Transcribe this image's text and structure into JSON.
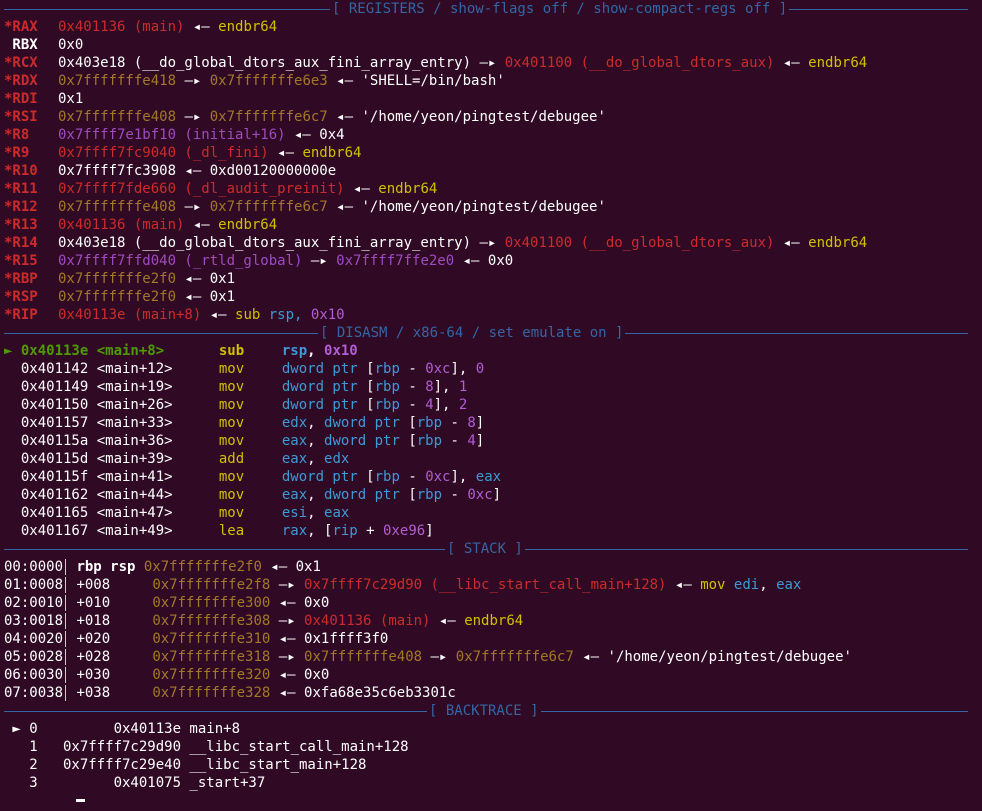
{
  "headers": {
    "registers": "[ REGISTERS / show-flags off / show-compact-regs off ]",
    "disasm": "[ DISASM / x86-64 / set emulate on ]",
    "stack": "[ STACK ]",
    "backtrace": "[ BACKTRACE ]"
  },
  "registers": [
    {
      "name": "*RAX",
      "parts": [
        [
          "0x401136 (main)",
          "red"
        ],
        [
          " ◂— ",
          "wht"
        ],
        [
          "endbr64",
          "ylw"
        ]
      ]
    },
    {
      "name": " RBX",
      "parts": [
        [
          "0x0",
          "wht"
        ]
      ]
    },
    {
      "name": "*RCX",
      "parts": [
        [
          "0x403e18 (__do_global_dtors_aux_fini_array_entry)",
          "wht"
        ],
        [
          " —▸ ",
          "wht"
        ],
        [
          "0x401100 (__do_global_dtors_aux)",
          "red"
        ],
        [
          " ◂— ",
          "wht"
        ],
        [
          "endbr64",
          "ylw"
        ]
      ]
    },
    {
      "name": "*RDX",
      "parts": [
        [
          "0x7fffffffe418",
          "brn"
        ],
        [
          " —▸ ",
          "wht"
        ],
        [
          "0x7fffffffe6e3",
          "brn"
        ],
        [
          " ◂— 'SHELL=/bin/bash'",
          "wht"
        ]
      ]
    },
    {
      "name": "*RDI",
      "parts": [
        [
          "0x1",
          "wht"
        ]
      ]
    },
    {
      "name": "*RSI",
      "parts": [
        [
          "0x7fffffffe408",
          "brn"
        ],
        [
          " —▸ ",
          "wht"
        ],
        [
          "0x7fffffffe6c7",
          "brn"
        ],
        [
          " ◂— '/home/yeon/pingtest/debugee'",
          "wht"
        ]
      ]
    },
    {
      "name": "*R8",
      "parts": [
        [
          "0x7ffff7e1bf10 (initial+16)",
          "pur"
        ],
        [
          " ◂— 0x4",
          "wht"
        ]
      ]
    },
    {
      "name": "*R9",
      "parts": [
        [
          "0x7ffff7fc9040 (_dl_fini)",
          "red"
        ],
        [
          " ◂— ",
          "wht"
        ],
        [
          "endbr64",
          "ylw"
        ]
      ]
    },
    {
      "name": "*R10",
      "parts": [
        [
          "0x7ffff7fc3908",
          "wht"
        ],
        [
          " ◂— 0xd00120000000e",
          "wht"
        ]
      ]
    },
    {
      "name": "*R11",
      "parts": [
        [
          "0x7ffff7fde660 (_dl_audit_preinit)",
          "red"
        ],
        [
          " ◂— ",
          "wht"
        ],
        [
          "endbr64",
          "ylw"
        ]
      ]
    },
    {
      "name": "*R12",
      "parts": [
        [
          "0x7fffffffe408",
          "brn"
        ],
        [
          " —▸ ",
          "wht"
        ],
        [
          "0x7fffffffe6c7",
          "brn"
        ],
        [
          " ◂— '/home/yeon/pingtest/debugee'",
          "wht"
        ]
      ]
    },
    {
      "name": "*R13",
      "parts": [
        [
          "0x401136 (main)",
          "red"
        ],
        [
          " ◂— ",
          "wht"
        ],
        [
          "endbr64",
          "ylw"
        ]
      ]
    },
    {
      "name": "*R14",
      "parts": [
        [
          "0x403e18 (__do_global_dtors_aux_fini_array_entry)",
          "wht"
        ],
        [
          " —▸ ",
          "wht"
        ],
        [
          "0x401100 (__do_global_dtors_aux)",
          "red"
        ],
        [
          " ◂— ",
          "wht"
        ],
        [
          "endbr64",
          "ylw"
        ]
      ]
    },
    {
      "name": "*R15",
      "parts": [
        [
          "0x7ffff7ffd040 (_rtld_global)",
          "pur"
        ],
        [
          " —▸ ",
          "wht"
        ],
        [
          "0x7ffff7ffe2e0",
          "pur"
        ],
        [
          " ◂— 0x0",
          "wht"
        ]
      ]
    },
    {
      "name": "*RBP",
      "parts": [
        [
          "0x7fffffffe2f0",
          "brn"
        ],
        [
          " ◂— 0x1",
          "wht"
        ]
      ]
    },
    {
      "name": "*RSP",
      "parts": [
        [
          "0x7fffffffe2f0",
          "brn"
        ],
        [
          " ◂— 0x1",
          "wht"
        ]
      ]
    },
    {
      "name": "*RIP",
      "parts": [
        [
          "0x40113e (main+8)",
          "red"
        ],
        [
          " ◂— ",
          "wht"
        ],
        [
          "sub ",
          "ylw"
        ],
        [
          "rsp, ",
          "cyn"
        ],
        [
          "0x10",
          "mag"
        ]
      ]
    }
  ],
  "disasm": [
    {
      "marker": "►",
      "addr": "0x40113e <main+8>",
      "mn": "sub",
      "ops": [
        [
          "rsp",
          "cyn"
        ],
        [
          ", ",
          "wht"
        ],
        [
          "0x10",
          "mag"
        ]
      ],
      "current": true
    },
    {
      "marker": " ",
      "addr": "0x401142 <main+12>",
      "mn": "mov",
      "ops": [
        [
          "dword ptr ",
          "cyn"
        ],
        [
          "[",
          "wht"
        ],
        [
          "rbp",
          "cyn"
        ],
        [
          " - ",
          "wht"
        ],
        [
          "0xc",
          "mag"
        ],
        [
          "], ",
          "wht"
        ],
        [
          "0",
          "mag"
        ]
      ]
    },
    {
      "marker": " ",
      "addr": "0x401149 <main+19>",
      "mn": "mov",
      "ops": [
        [
          "dword ptr ",
          "cyn"
        ],
        [
          "[",
          "wht"
        ],
        [
          "rbp",
          "cyn"
        ],
        [
          " - ",
          "wht"
        ],
        [
          "8",
          "mag"
        ],
        [
          "], ",
          "wht"
        ],
        [
          "1",
          "mag"
        ]
      ]
    },
    {
      "marker": " ",
      "addr": "0x401150 <main+26>",
      "mn": "mov",
      "ops": [
        [
          "dword ptr ",
          "cyn"
        ],
        [
          "[",
          "wht"
        ],
        [
          "rbp",
          "cyn"
        ],
        [
          " - ",
          "wht"
        ],
        [
          "4",
          "mag"
        ],
        [
          "], ",
          "wht"
        ],
        [
          "2",
          "mag"
        ]
      ]
    },
    {
      "marker": " ",
      "addr": "0x401157 <main+33>",
      "mn": "mov",
      "ops": [
        [
          "edx",
          "cyn"
        ],
        [
          ", ",
          "wht"
        ],
        [
          "dword ptr ",
          "cyn"
        ],
        [
          "[",
          "wht"
        ],
        [
          "rbp",
          "cyn"
        ],
        [
          " - ",
          "wht"
        ],
        [
          "8",
          "mag"
        ],
        [
          "]",
          "wht"
        ]
      ]
    },
    {
      "marker": " ",
      "addr": "0x40115a <main+36>",
      "mn": "mov",
      "ops": [
        [
          "eax",
          "cyn"
        ],
        [
          ", ",
          "wht"
        ],
        [
          "dword ptr ",
          "cyn"
        ],
        [
          "[",
          "wht"
        ],
        [
          "rbp",
          "cyn"
        ],
        [
          " - ",
          "wht"
        ],
        [
          "4",
          "mag"
        ],
        [
          "]",
          "wht"
        ]
      ]
    },
    {
      "marker": " ",
      "addr": "0x40115d <main+39>",
      "mn": "add",
      "ops": [
        [
          "eax",
          "cyn"
        ],
        [
          ", ",
          "wht"
        ],
        [
          "edx",
          "cyn"
        ]
      ]
    },
    {
      "marker": " ",
      "addr": "0x40115f <main+41>",
      "mn": "mov",
      "ops": [
        [
          "dword ptr ",
          "cyn"
        ],
        [
          "[",
          "wht"
        ],
        [
          "rbp",
          "cyn"
        ],
        [
          " - ",
          "wht"
        ],
        [
          "0xc",
          "mag"
        ],
        [
          "], ",
          "wht"
        ],
        [
          "eax",
          "cyn"
        ]
      ]
    },
    {
      "marker": " ",
      "addr": "0x401162 <main+44>",
      "mn": "mov",
      "ops": [
        [
          "eax",
          "cyn"
        ],
        [
          ", ",
          "wht"
        ],
        [
          "dword ptr ",
          "cyn"
        ],
        [
          "[",
          "wht"
        ],
        [
          "rbp",
          "cyn"
        ],
        [
          " - ",
          "wht"
        ],
        [
          "0xc",
          "mag"
        ],
        [
          "]",
          "wht"
        ]
      ]
    },
    {
      "marker": " ",
      "addr": "0x401165 <main+47>",
      "mn": "mov",
      "ops": [
        [
          "esi",
          "cyn"
        ],
        [
          ", ",
          "wht"
        ],
        [
          "eax",
          "cyn"
        ]
      ]
    },
    {
      "marker": " ",
      "addr": "0x401167 <main+49>",
      "mn": "lea",
      "ops": [
        [
          "rax",
          "cyn"
        ],
        [
          ", [",
          "wht"
        ],
        [
          "rip",
          "cyn"
        ],
        [
          " + ",
          "wht"
        ],
        [
          "0xe96",
          "mag"
        ],
        [
          "]",
          "wht"
        ]
      ]
    }
  ],
  "stack": [
    {
      "idx": "00:0000",
      "off": " rbp rsp ",
      "parts": [
        [
          "0x7fffffffe2f0",
          "brn"
        ],
        [
          " ◂— 0x1",
          "wht"
        ]
      ]
    },
    {
      "idx": "01:0008",
      "off": " +008     ",
      "parts": [
        [
          "0x7fffffffe2f8",
          "brn"
        ],
        [
          " —▸ ",
          "wht"
        ],
        [
          "0x7ffff7c29d90 (__libc_start_call_main+128)",
          "red"
        ],
        [
          " ◂— ",
          "wht"
        ],
        [
          "mov ",
          "ylw"
        ],
        [
          "edi",
          "cyn"
        ],
        [
          ", ",
          "wht"
        ],
        [
          "eax",
          "cyn"
        ]
      ]
    },
    {
      "idx": "02:0010",
      "off": " +010     ",
      "parts": [
        [
          "0x7fffffffe300",
          "brn"
        ],
        [
          " ◂— 0x0",
          "wht"
        ]
      ]
    },
    {
      "idx": "03:0018",
      "off": " +018     ",
      "parts": [
        [
          "0x7fffffffe308",
          "brn"
        ],
        [
          " —▸ ",
          "wht"
        ],
        [
          "0x401136 (main)",
          "red"
        ],
        [
          " ◂— ",
          "wht"
        ],
        [
          "endbr64",
          "ylw"
        ]
      ]
    },
    {
      "idx": "04:0020",
      "off": " +020     ",
      "parts": [
        [
          "0x7fffffffe310",
          "brn"
        ],
        [
          " ◂— 0x1ffff3f0",
          "wht"
        ]
      ]
    },
    {
      "idx": "05:0028",
      "off": " +028     ",
      "parts": [
        [
          "0x7fffffffe318",
          "brn"
        ],
        [
          " —▸ ",
          "wht"
        ],
        [
          "0x7fffffffe408",
          "brn"
        ],
        [
          " —▸ ",
          "wht"
        ],
        [
          "0x7fffffffe6c7",
          "brn"
        ],
        [
          " ◂— '/home/yeon/pingtest/debugee'",
          "wht"
        ]
      ]
    },
    {
      "idx": "06:0030",
      "off": " +030     ",
      "parts": [
        [
          "0x7fffffffe320",
          "brn"
        ],
        [
          " ◂— 0x0",
          "wht"
        ]
      ]
    },
    {
      "idx": "07:0038",
      "off": " +038     ",
      "parts": [
        [
          "0x7fffffffe328",
          "brn"
        ],
        [
          " ◂— 0xfa68e35c6eb3301c",
          "wht"
        ]
      ]
    }
  ],
  "backtrace": [
    {
      "text": " ► 0         0x40113e main+8"
    },
    {
      "text": "   1   0x7ffff7c29d90 __libc_start_call_main+128"
    },
    {
      "text": "   2   0x7ffff7c29e40 __libc_start_main+128"
    },
    {
      "text": "   3         0x401075 _start+37"
    }
  ]
}
